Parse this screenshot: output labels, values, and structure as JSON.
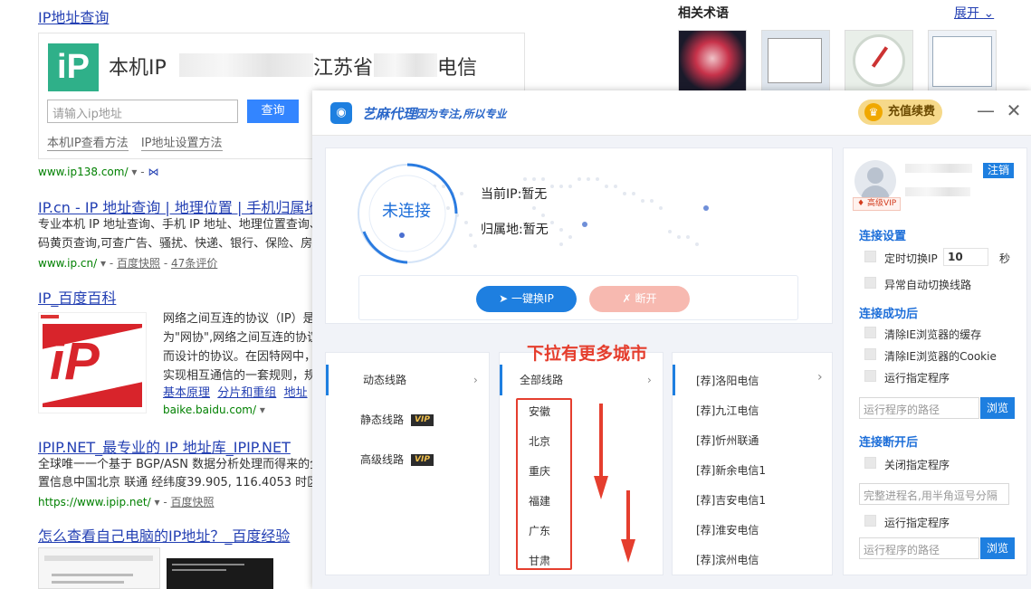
{
  "search": {
    "r1_title": "IP地址查询",
    "r1_ip_label": "本机IP",
    "r1_ip_suffix_a": "江苏省",
    "r1_ip_suffix_b": "电信",
    "r1_input_placeholder": "请输入ip地址",
    "r1_button": "查询",
    "r1_link1": "本机IP查看方法",
    "r1_link2": "IP地址设置方法",
    "r1_source": "www.ip138.com/",
    "r2_title": "IP.cn - IP 地址查询 | 地理位置 | 手机归属地",
    "r2_line1": "专业本机 IP 地址查询、手机 IP 地址、地理位置查询、",
    "r2_line2": "码黄页查询,可查广告、骚扰、快递、银行、保险、房",
    "r2_source": "www.ip.cn/",
    "r2_snapshot": "百度快照",
    "r2_reviews": "47条评价",
    "r3_title": "IP_百度百科",
    "r3_line1": "网络之间互连的协议（IP）是",
    "r3_line2": "为\"网协\",网络之间互连的协议",
    "r3_line3": "而设计的协议。在因特网中，",
    "r3_line4": "实现相互通信的一套规则，规",
    "r3_link1": "基本原理",
    "r3_link2": "分片和重组",
    "r3_link3": "地址",
    "r3_source": "baike.baidu.com/",
    "r4_title": "IPIP.NET_最专业的 IP 地址库_IPIP.NET",
    "r4_line1": "全球唯一一个基于 BGP/ASN 数据分析处理而得来的全",
    "r4_line2": "置信息中国北京 联通 经纬度39.905, 116.4053 时区A",
    "r4_source": "https://www.ipip.net/",
    "r4_snapshot": "百度快照",
    "r5_title": "怎么查看自己电脑的IP地址？_百度经验"
  },
  "related": {
    "title": "相关术语",
    "expand": "展开"
  },
  "app": {
    "name": "艺麻代理",
    "slogan": "因为专注,所以专业",
    "recharge": "充值续费",
    "status_ring": "未连接",
    "current_ip": "当前IP:暂无",
    "location": "归属地:暂无",
    "connect_btn": "一键换IP",
    "disconnect_btn": "断开",
    "menu": [
      {
        "label": "动态线路",
        "vip": ""
      },
      {
        "label": "静态线路",
        "vip": "VIP"
      },
      {
        "label": "高级线路",
        "vip": "VIP"
      }
    ],
    "region_header": "全部线路",
    "cities": [
      "安徽",
      "北京",
      "重庆",
      "福建",
      "广东",
      "甘肃"
    ],
    "lines": [
      "[荐]洛阳电信",
      "[荐]九江电信",
      "[荐]忻州联通",
      "[荐]新余电信1",
      "[荐]吉安电信1",
      "[荐]淮安电信",
      "[荐]滨州电信"
    ],
    "annotation": "下拉有更多城市",
    "user_badge": "高级VIP",
    "logout": "注销",
    "sec_connect_settings": "连接设置",
    "opt_timed_switch": "定时切换IP",
    "timed_value": "10",
    "timed_unit": "秒",
    "opt_auto_switch": "异常自动切换线路",
    "sec_after_connect": "连接成功后",
    "opt_clear_cache": "清除IE浏览器的缓存",
    "opt_clear_cookie": "清除IE浏览器的Cookie",
    "opt_run_program": "运行指定程序",
    "program_path_placeholder": "运行程序的路径",
    "browse": "浏览",
    "sec_after_disconnect": "连接断开后",
    "opt_close_program": "关闭指定程序",
    "process_placeholder": "完整进程名,用半角逗号分隔",
    "opt_run_program2": "运行指定程序",
    "program_path_placeholder2": "运行程序的路径",
    "browse2": "浏览"
  }
}
